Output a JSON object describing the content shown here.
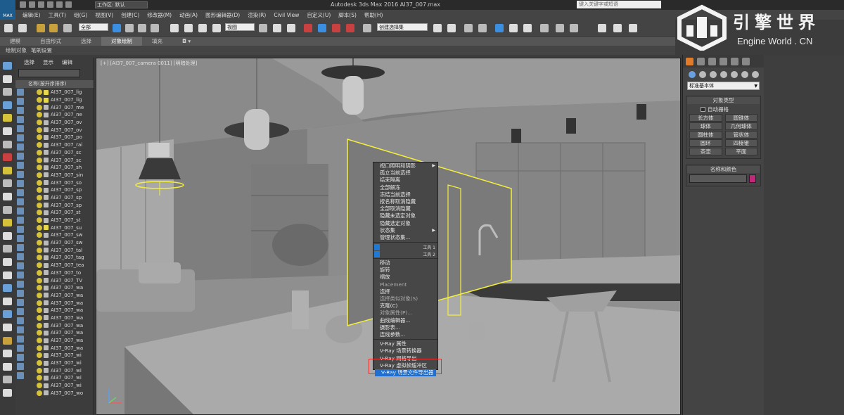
{
  "titlebar": {
    "logo_text": "MAX",
    "workspace": "工作区: 默认",
    "app_title": "Autodesk 3ds Max 2016      AI37_007.max",
    "search_placeholder": "键入关键字或短语"
  },
  "menubar": [
    "编辑(E)",
    "工具(T)",
    "组(G)",
    "视图(V)",
    "创建(C)",
    "修改器(M)",
    "动画(A)",
    "图形编辑器(D)",
    "渲染(R)",
    "Civil View",
    "自定义(U)",
    "脚本(S)",
    "帮助(H)"
  ],
  "toolbar": {
    "selection_filter": "全部",
    "view_reference": "视图",
    "create_selection_set": "创建选择集"
  },
  "ribbon": {
    "tabs": [
      "建模",
      "自由形式",
      "选择",
      "对象绘制",
      "填充"
    ],
    "active_tab": "对象绘制",
    "sub_tabs": [
      "绘制对象",
      "笔刷设置"
    ]
  },
  "explorer": {
    "tabs": [
      "选择",
      "显示",
      "编辑"
    ],
    "column_header": "名称(按升序排序)",
    "rows": [
      {
        "name": "AI37_007_lig",
        "type": "light"
      },
      {
        "name": "AI37_007_lig",
        "type": "light"
      },
      {
        "name": "AI37_007_me",
        "type": "geo"
      },
      {
        "name": "AI37_007_ne",
        "type": "geo"
      },
      {
        "name": "AI37_007_ov",
        "type": "geo"
      },
      {
        "name": "AI37_007_ov",
        "type": "geo"
      },
      {
        "name": "AI37_007_po",
        "type": "geo"
      },
      {
        "name": "AI37_007_rai",
        "type": "geo"
      },
      {
        "name": "AI37_007_sc",
        "type": "geo"
      },
      {
        "name": "AI37_007_sc",
        "type": "geo"
      },
      {
        "name": "AI37_007_sh",
        "type": "geo"
      },
      {
        "name": "AI37_007_sin",
        "type": "geo"
      },
      {
        "name": "AI37_007_so",
        "type": "geo"
      },
      {
        "name": "AI37_007_sp",
        "type": "geo"
      },
      {
        "name": "AI37_007_sp",
        "type": "geo"
      },
      {
        "name": "AI37_007_sp",
        "type": "geo"
      },
      {
        "name": "AI37_007_st",
        "type": "geo"
      },
      {
        "name": "AI37_007_st",
        "type": "geo"
      },
      {
        "name": "AI37_007_su",
        "type": "light"
      },
      {
        "name": "AI37_007_sw",
        "type": "geo"
      },
      {
        "name": "AI37_007_sw",
        "type": "geo"
      },
      {
        "name": "AI37_007_tal",
        "type": "geo"
      },
      {
        "name": "AI37_007_tag",
        "type": "geo"
      },
      {
        "name": "AI37_007_tea",
        "type": "geo"
      },
      {
        "name": "AI37_007_to",
        "type": "geo"
      },
      {
        "name": "AI37_007_TV",
        "type": "geo"
      },
      {
        "name": "AI37_007_wa",
        "type": "geo"
      },
      {
        "name": "AI37_007_wa",
        "type": "geo"
      },
      {
        "name": "AI37_007_wa",
        "type": "geo"
      },
      {
        "name": "AI37_007_wa",
        "type": "geo"
      },
      {
        "name": "AI37_007_wa",
        "type": "geo"
      },
      {
        "name": "AI37_007_wa",
        "type": "geo"
      },
      {
        "name": "AI37_007_wa",
        "type": "geo"
      },
      {
        "name": "AI37_007_wa",
        "type": "geo"
      },
      {
        "name": "AI37_007_wa",
        "type": "geo"
      },
      {
        "name": "AI37_007_wi",
        "type": "geo"
      },
      {
        "name": "AI37_007_wi",
        "type": "geo"
      },
      {
        "name": "AI37_007_wi",
        "type": "geo"
      },
      {
        "name": "AI37_007_wi",
        "type": "geo"
      },
      {
        "name": "AI37_007_wi",
        "type": "geo"
      },
      {
        "name": "AI37_007_wo",
        "type": "geo"
      }
    ]
  },
  "viewport": {
    "label": "[+] [AI37_007_camera 0011] [明暗处理]"
  },
  "context_menu": {
    "items": [
      {
        "label": "视口照明和阴影",
        "submenu": true,
        "dim": false
      },
      {
        "label": "孤立当前选择",
        "dim": false
      },
      {
        "label": "结束隔离",
        "dim": false
      },
      {
        "label": "全部解冻",
        "dim": false
      },
      {
        "label": "冻结当前选择",
        "dim": false
      },
      {
        "label": "按名称取消隐藏",
        "dim": false
      },
      {
        "label": "全部取消隐藏",
        "dim": false
      },
      {
        "label": "隐藏未选定对象",
        "dim": false
      },
      {
        "label": "隐藏选定对象",
        "dim": false
      },
      {
        "label": "状态集",
        "submenu": true,
        "dim": false
      },
      {
        "label": "管理状态集...",
        "dim": false
      },
      {
        "label": "sep"
      },
      {
        "label": "blue1",
        "right": "工具 1"
      },
      {
        "label": "blue2",
        "right": "工具 2"
      },
      {
        "label": "sep"
      },
      {
        "label": "移动",
        "dim": false
      },
      {
        "label": "旋转",
        "dim": false
      },
      {
        "label": "缩放",
        "dim": false
      },
      {
        "label": "Placement",
        "dim": true
      },
      {
        "label": "选择",
        "dim": false
      },
      {
        "label": "选择类似对象(S)",
        "dim": true
      },
      {
        "label": "克隆(C)",
        "dim": false
      },
      {
        "label": "对象属性(P)...",
        "dim": true
      },
      {
        "label": "曲线编辑器...",
        "dim": false
      },
      {
        "label": "摄影表...",
        "dim": false
      },
      {
        "label": "连线参数...",
        "dim": false
      },
      {
        "label": "sep"
      },
      {
        "label": "V-Ray 属性",
        "dim": false
      },
      {
        "label": "V-Ray 场景转换器",
        "dim": false
      },
      {
        "label": "V-Ray 网格导出",
        "dim": false
      },
      {
        "label": "V-Ray 虚拟帧缓冲区",
        "dim": false
      },
      {
        "label": "V-Ray 场景文件导出器",
        "highlight": true
      }
    ]
  },
  "command_panel": {
    "primitive_type": "标准基本体",
    "rollout_object_type": "对象类型",
    "autogrid": "自动栅格",
    "buttons": [
      "长方体",
      "圆锥体",
      "球体",
      "几何球体",
      "圆柱体",
      "管状体",
      "圆环",
      "四棱锥",
      "茶壶",
      "平面"
    ],
    "rollout_name_color": "名称和颜色",
    "object_color": "#c3277a"
  },
  "watermark": {
    "main": "引擎世界",
    "sub": "Engine World . CN"
  }
}
